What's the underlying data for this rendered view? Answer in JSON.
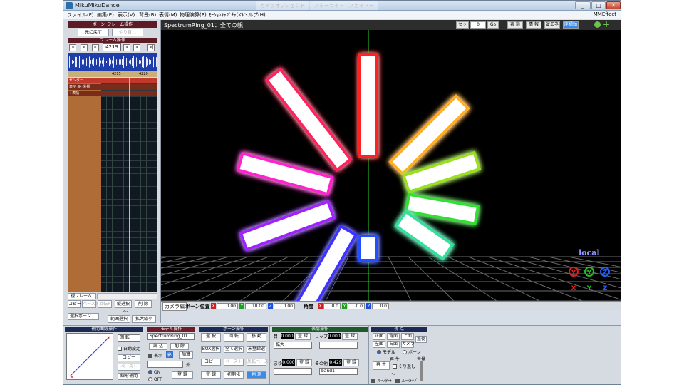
{
  "window": {
    "title": "MikuMikuDance",
    "ghost_tabs": [
      "カメラオブジェクト",
      "スターライト（スカイドー"
    ],
    "minimize": "_",
    "maximize": "□",
    "close": "✕"
  },
  "menu": {
    "items": [
      "ファイル(F)",
      "編集(E)",
      "表示(V)",
      "背景(B)",
      "表情(M)",
      "物理演算(P)",
      "ﾓｰｼｮﾝｷｬﾌﾟﾁｬ(K)",
      "ヘルプ(H)"
    ],
    "mmeffect": "MMEffect"
  },
  "left": {
    "bone_header": "ボーン･フレーム操作",
    "undo": "元に戻す",
    "redo": "やり直し",
    "frame_header": "フレーム操作",
    "nav": [
      "|<",
      "<",
      "<",
      ">",
      ">",
      ">|"
    ],
    "frame_value": "4219",
    "ruler_marks": [
      "4215",
      "4220"
    ],
    "tracks": [
      "センター",
      "表示･IK･外観",
      "+表情"
    ],
    "view_frame": "視フレーム",
    "row1": [
      "コピー",
      "ペースト",
      "反転P",
      "縦選択",
      "削 除"
    ],
    "row2": [
      "範囲選択",
      "拡大縮小"
    ],
    "bone_select": "選択ボーン",
    "tilde": "～"
  },
  "viewport": {
    "title": "SpectrumRing_01：全ての親",
    "buttons": [
      "セット",
      "0",
      "Go",
      "表 影",
      "情 報",
      "省エネ",
      "座標軸"
    ],
    "local": "local",
    "axes_top": [
      "Y",
      "Y",
      "Z"
    ],
    "axes_bottom": [
      "X",
      "Y",
      "Z"
    ],
    "axis_colors": {
      "x": "#e02020",
      "y": "#20c020",
      "z": "#2060ff"
    }
  },
  "camera_bar": {
    "tab": "カメラ編",
    "bone_pos_label": "ボーン位置",
    "pos": {
      "x": "0.00",
      "y": "10.00",
      "z": "0.00"
    },
    "angle_label": "角度",
    "angle": {
      "x": "0.0",
      "y": "0.0",
      "z": "0.0"
    },
    "axis_labels": {
      "x": "X",
      "y": "Y",
      "z": "Z"
    }
  },
  "panels": {
    "interp": {
      "header": "補間曲線操作",
      "select": "回 転",
      "auto": "自動設定",
      "copy": "コピー",
      "paste": "ペースト",
      "linear": "線形補間"
    },
    "model": {
      "header": "モデル操作",
      "model_select": "SpectrumRing_01",
      "load": "読 込",
      "delete": "削 除",
      "display": "表示",
      "shadow": "影",
      "add": "加算",
      "outer": "外",
      "on": "ON",
      "off": "OFF",
      "register": "登 録"
    },
    "bone": {
      "header": "ボーン操作",
      "select": "選 択",
      "rotate": "回 転",
      "move": "移 動",
      "box_select": "BOX選択",
      "select_all": "全て選択",
      "unreg_select": "未登録選",
      "copy": "コピー",
      "paste": "ペースト",
      "flip_paste": "反転ペースト",
      "register": "登 録",
      "init": "初期化",
      "physics": "物 理"
    },
    "morph": {
      "header": "表情操作",
      "eye": "目",
      "eye_val": "0.000",
      "lip": "リップ",
      "lip_val": "0.000",
      "eye_select": "拡大",
      "brow": "まゆ",
      "brow_val": "0.000",
      "other": "その他",
      "other_val": "0.429",
      "other_select": "band1",
      "register": "登 録"
    },
    "view": {
      "header": "視 点",
      "front": "正面",
      "back": "背面",
      "top": "上面",
      "track": "追従",
      "left": "左面",
      "right": "右面",
      "camera": "カメラ",
      "model": "モデル",
      "bone": "ボーン",
      "play_header": "再 生",
      "play": "再 生",
      "repeat": "くり返し",
      "volume": "音量",
      "frame_stop": "ﾌﾚｰｽﾀｰﾄ",
      "frame_end": "ﾌﾚｰｽﾄｯﾌﾟ",
      "tilde": "～"
    }
  }
}
